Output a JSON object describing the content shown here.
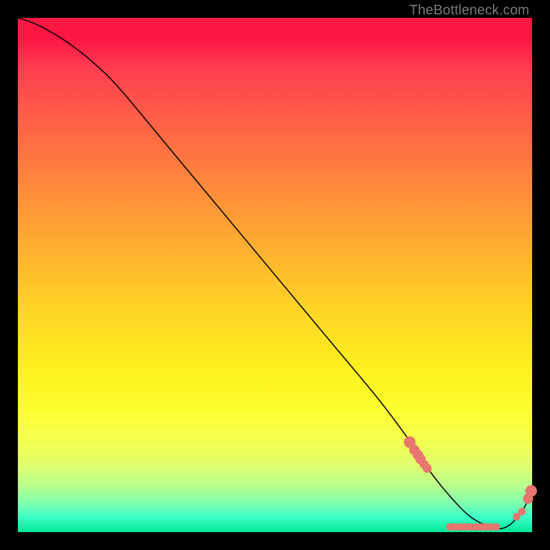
{
  "attribution": "TheBottleneck.com",
  "colors": {
    "background": "#000000",
    "gradient_top": "#ff1744",
    "gradient_bottom": "#00e89a",
    "curve": "#000000",
    "dot": "#e8766f"
  },
  "chart_data": {
    "type": "line",
    "title": "",
    "xlabel": "",
    "ylabel": "",
    "xlim": [
      0,
      100
    ],
    "ylim": [
      0,
      100
    ],
    "x": [
      0,
      3,
      6,
      10,
      15,
      20,
      30,
      40,
      50,
      60,
      70,
      76,
      80,
      84,
      88,
      92,
      95,
      98,
      100
    ],
    "values": [
      100,
      99,
      97.5,
      95,
      91,
      86,
      74,
      62,
      50,
      38,
      26,
      18,
      12,
      7,
      3,
      1,
      1,
      4,
      8
    ],
    "markers": {
      "x": [
        76.2,
        77.1,
        77.8,
        78.3,
        79.0,
        79.6,
        84.0,
        85.0,
        86.0,
        87.0,
        88.0,
        89.0,
        90.0,
        91.0,
        92.0,
        93.0,
        97.0,
        98.0,
        99.2,
        99.8
      ],
      "y": [
        17.5,
        16.0,
        15.0,
        14.2,
        13.2,
        12.4,
        1.0,
        1.0,
        1.0,
        1.0,
        1.0,
        1.0,
        1.0,
        1.0,
        1.0,
        1.0,
        3.0,
        4.0,
        6.5,
        8.0
      ],
      "r": [
        8,
        7,
        7,
        7,
        6,
        6,
        5,
        5,
        5,
        5,
        5,
        5,
        5,
        5,
        5,
        5,
        5,
        5,
        7,
        8
      ]
    }
  }
}
